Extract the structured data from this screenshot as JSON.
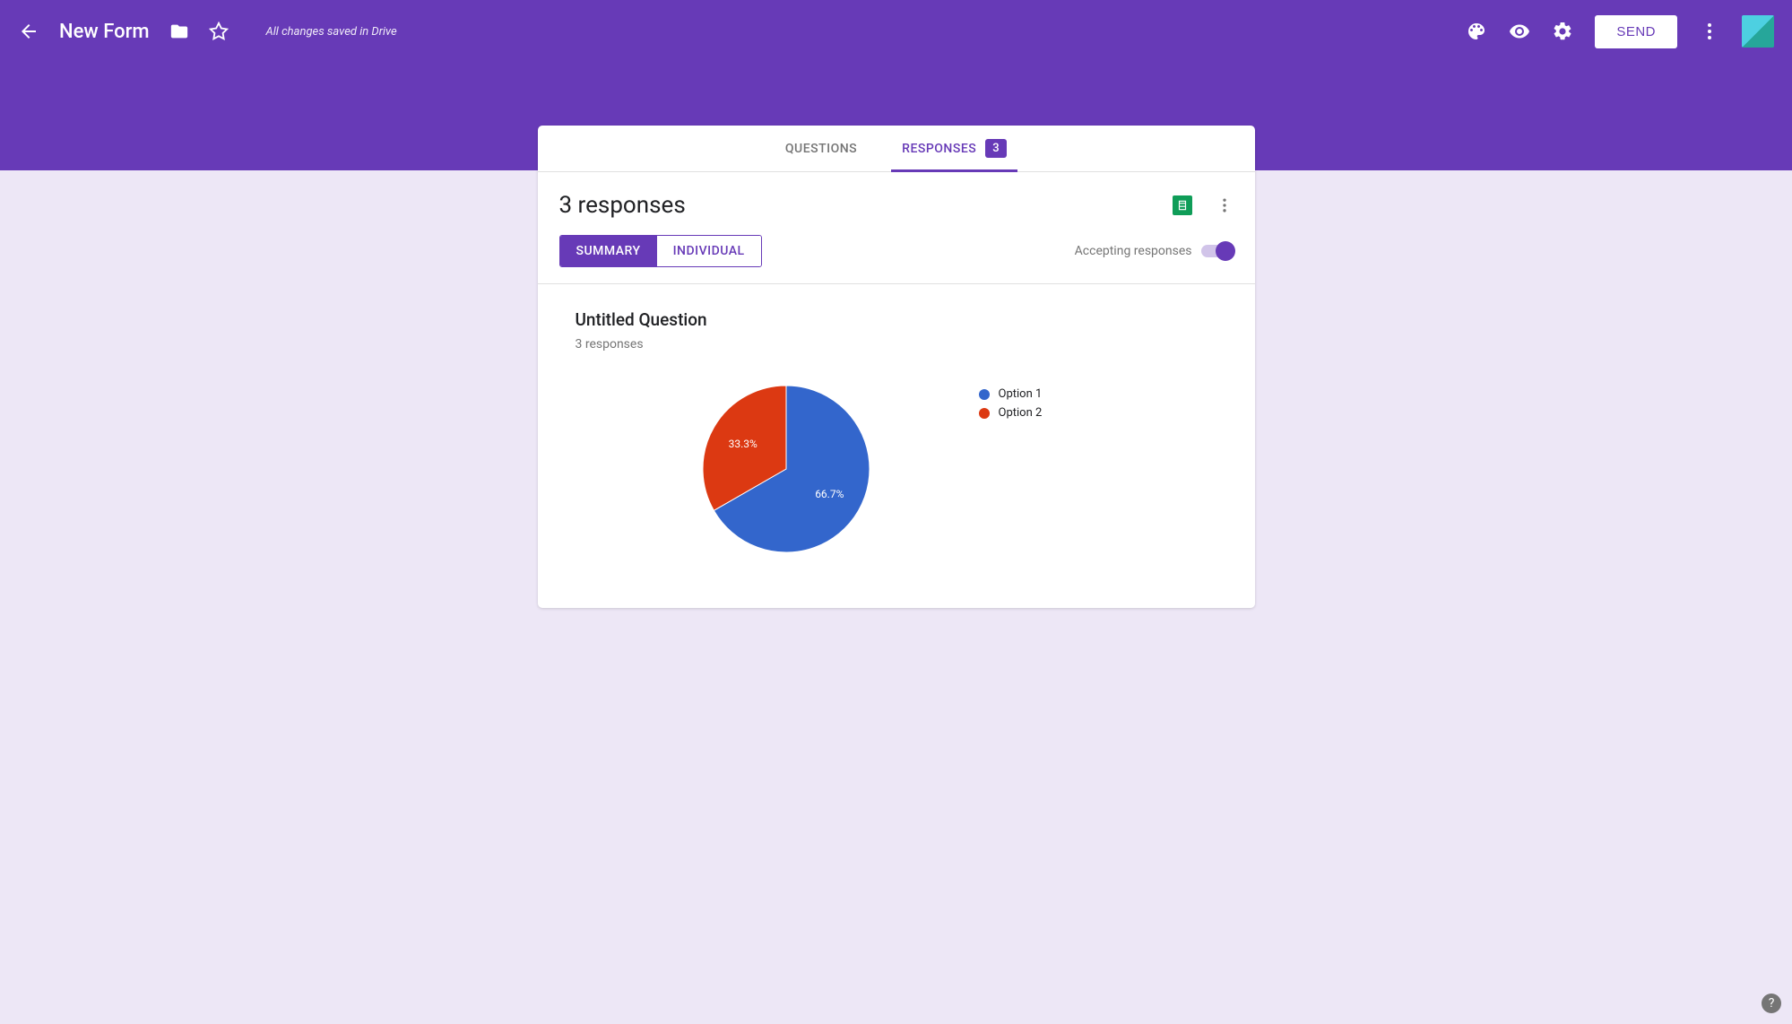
{
  "header": {
    "title": "New Form",
    "saved_text": "All changes saved in Drive",
    "send_label": "SEND"
  },
  "tabs": {
    "questions": "QUESTIONS",
    "responses": "RESPONSES",
    "badge": "3"
  },
  "responses": {
    "title": "3 responses",
    "summary_label": "SUMMARY",
    "individual_label": "INDIVIDUAL",
    "accepting_label": "Accepting responses"
  },
  "question": {
    "title": "Untitled Question",
    "count": "3 responses"
  },
  "legend": {
    "items": [
      {
        "label": "Option 1",
        "color": "#3366cc"
      },
      {
        "label": "Option 2",
        "color": "#dc3912"
      }
    ]
  },
  "chart_data": {
    "type": "pie",
    "title": "Untitled Question",
    "series": [
      {
        "name": "Option 1",
        "value": 66.7,
        "label": "66.7%",
        "color": "#3366cc"
      },
      {
        "name": "Option 2",
        "value": 33.3,
        "label": "33.3%",
        "color": "#dc3912"
      }
    ]
  }
}
